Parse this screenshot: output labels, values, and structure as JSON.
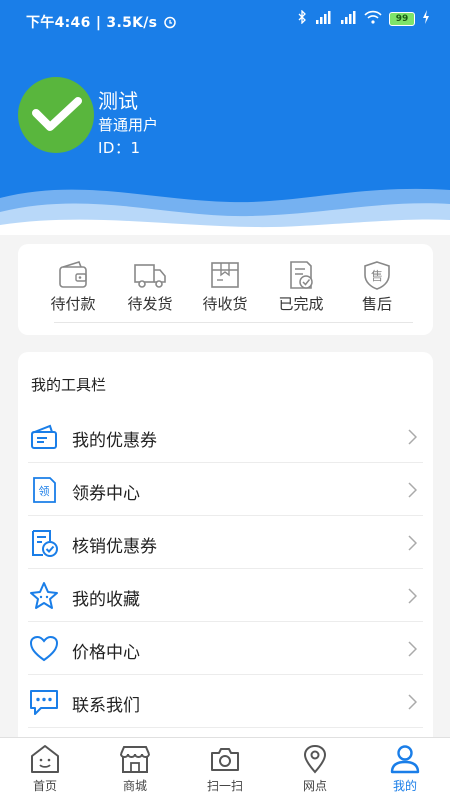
{
  "status_bar": {
    "time": "下午4:46",
    "speed": "3.5K/s",
    "battery": "99",
    "icons": [
      "alarm-icon",
      "bluetooth-icon",
      "signal-icon",
      "signal-icon",
      "wifi-icon",
      "battery-icon",
      "charging-icon"
    ]
  },
  "profile": {
    "name": "测试",
    "role": "普通用户",
    "id_text": "ID：1"
  },
  "orders": [
    {
      "label": "待付款",
      "icon": "wallet-icon"
    },
    {
      "label": "待发货",
      "icon": "truck-icon"
    },
    {
      "label": "待收货",
      "icon": "package-icon"
    },
    {
      "label": "已完成",
      "icon": "completed-doc-icon"
    },
    {
      "label": "售后",
      "icon": "after-sales-shield-icon"
    }
  ],
  "tools": {
    "title": "我的工具栏",
    "items": [
      {
        "label": "我的优惠券",
        "icon": "coupon-icon"
      },
      {
        "label": "领券中心",
        "icon": "coupon-center-icon"
      },
      {
        "label": "核销优惠券",
        "icon": "verify-coupon-icon"
      },
      {
        "label": "我的收藏",
        "icon": "star-icon"
      },
      {
        "label": "价格中心",
        "icon": "heart-icon"
      },
      {
        "label": "联系我们",
        "icon": "message-icon"
      }
    ]
  },
  "tabs": [
    {
      "label": "首页",
      "icon": "home-icon"
    },
    {
      "label": "商城",
      "icon": "store-icon"
    },
    {
      "label": "扫一扫",
      "icon": "camera-icon"
    },
    {
      "label": "网点",
      "icon": "location-icon"
    },
    {
      "label": "我的",
      "icon": "user-icon",
      "active": true
    }
  ],
  "colors": {
    "primary": "#1a7ee8",
    "avatar_green": "#59b63d",
    "background": "#f4f4f4"
  }
}
